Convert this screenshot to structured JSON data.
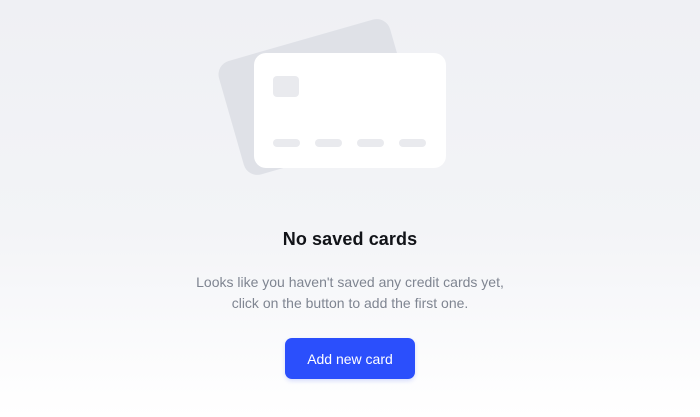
{
  "empty_state": {
    "title": "No saved cards",
    "description_line_1": "Looks like you haven't saved any credit cards yet,",
    "description_line_2": "click on the button to add the first one.",
    "button_label": "Add new card"
  },
  "colors": {
    "accent": "#2b4ffc",
    "background": "#eff0f4",
    "back_card": "#dfe1e7",
    "front_card": "#ffffff",
    "card_details": "#e9eaee",
    "title_text": "#111318",
    "muted_text": "#7f8591"
  },
  "icons": {
    "illustration": "credit-card-stack-icon"
  }
}
